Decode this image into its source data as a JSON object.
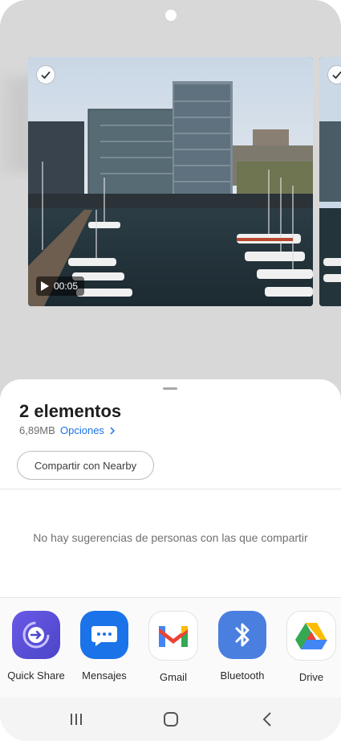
{
  "preview": {
    "items": [
      {
        "selected": true,
        "duration": "00:05"
      },
      {
        "selected": true
      }
    ]
  },
  "sheet": {
    "title": "2 elementos",
    "size": "6,89MB",
    "options_label": "Opciones",
    "nearby_button": "Compartir con Nearby",
    "no_suggestions": "No hay sugerencias de personas con las que compartir"
  },
  "apps": [
    {
      "label": "Quick Share",
      "icon": "quick-share-icon",
      "color": "#5b4fd6"
    },
    {
      "label": "Mensajes",
      "icon": "messages-icon",
      "color": "#1a73e8"
    },
    {
      "label": "Gmail",
      "icon": "gmail-icon",
      "color": "#ea4335"
    },
    {
      "label": "Bluetooth",
      "icon": "bluetooth-icon",
      "color": "#4a7fe0"
    },
    {
      "label": "Drive",
      "icon": "drive-icon",
      "color": "#34a853"
    }
  ],
  "navbar": {
    "recents": "recents-icon",
    "home": "home-icon",
    "back": "back-icon"
  }
}
